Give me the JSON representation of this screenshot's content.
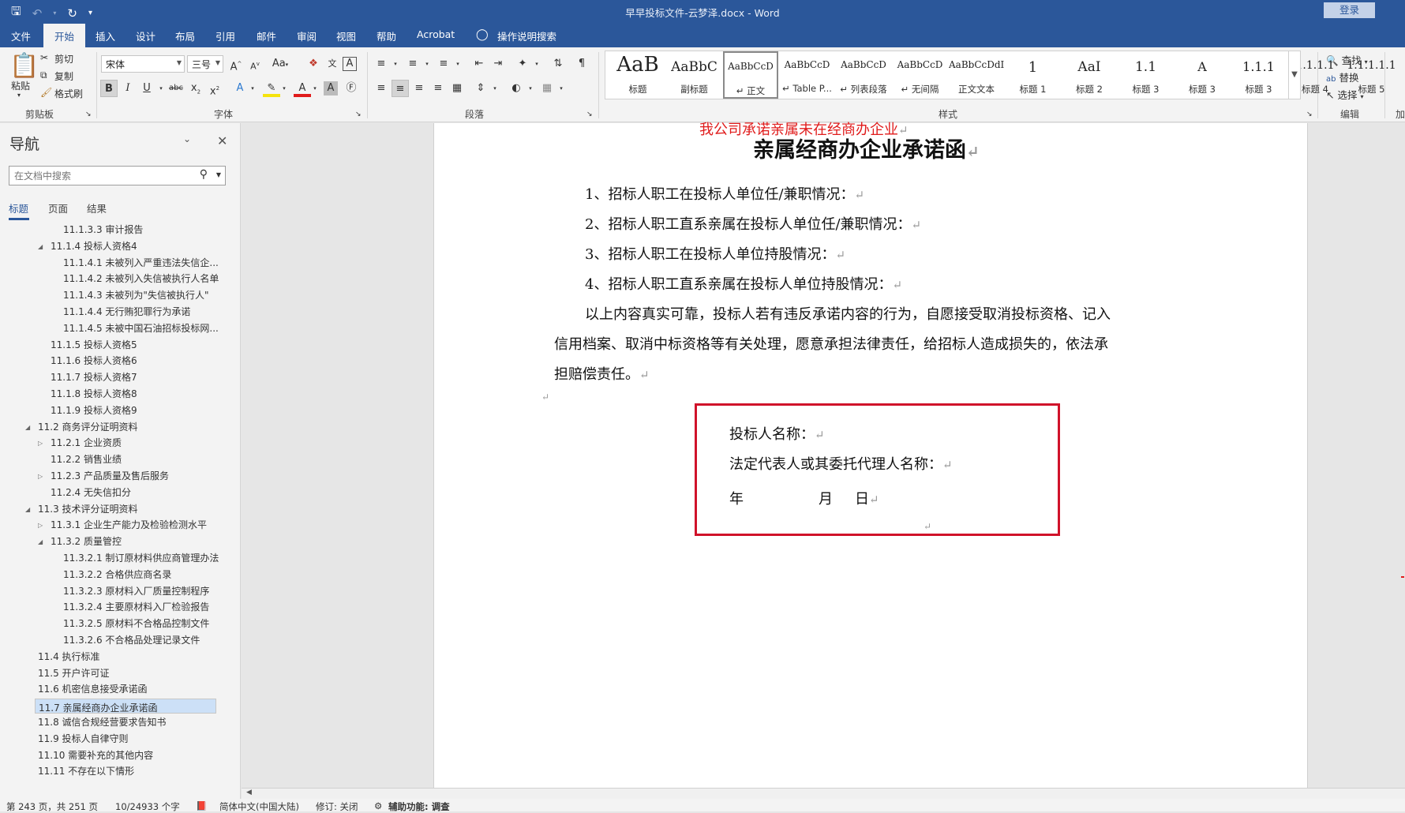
{
  "window": {
    "title": "早早投标文件-云梦泽.docx - Word",
    "login": "登录"
  },
  "menu": [
    {
      "label": "文件",
      "active": false
    },
    {
      "label": "开始",
      "active": true
    },
    {
      "label": "插入",
      "active": false
    },
    {
      "label": "设计",
      "active": false
    },
    {
      "label": "布局",
      "active": false
    },
    {
      "label": "引用",
      "active": false
    },
    {
      "label": "邮件",
      "active": false
    },
    {
      "label": "审阅",
      "active": false
    },
    {
      "label": "视图",
      "active": false
    },
    {
      "label": "帮助",
      "active": false
    },
    {
      "label": "Acrobat",
      "active": false
    },
    {
      "label": "操作说明搜索",
      "active": false
    }
  ],
  "ribbon": {
    "clipboard": {
      "paste": "粘贴",
      "cut": "剪切",
      "copy": "复制",
      "format_painter": "格式刷",
      "label": "剪贴板"
    },
    "font": {
      "name": "宋体",
      "size": "三号",
      "label": "字体",
      "case": "Aa"
    },
    "paragraph_label": "段落",
    "styles_label": "样式",
    "styles": [
      {
        "preview": "AaB",
        "name": "标题",
        "selected": false,
        "size": 26
      },
      {
        "preview": "AaBbC",
        "name": "副标题",
        "selected": false,
        "size": 17
      },
      {
        "preview": "AaBbCcD",
        "name": "↵ 正文",
        "selected": true,
        "size": 12
      },
      {
        "preview": "AaBbCcD",
        "name": "↵ Table P...",
        "selected": false,
        "size": 12
      },
      {
        "preview": "AaBbCcD",
        "name": "↵ 列表段落",
        "selected": false,
        "size": 12
      },
      {
        "preview": "AaBbCcD",
        "name": "↵ 无间隔",
        "selected": false,
        "size": 12
      },
      {
        "preview": "AaBbCcDdI",
        "name": "正文文本",
        "selected": false,
        "size": 12
      },
      {
        "preview": "1",
        "name": "标题 1",
        "selected": false,
        "size": 18
      },
      {
        "preview": "AaI",
        "name": "标题 2",
        "selected": false,
        "size": 17
      },
      {
        "preview": "1.1",
        "name": "标题 3",
        "selected": false,
        "size": 17
      },
      {
        "preview": "A",
        "name": "标题 3",
        "selected": false,
        "size": 16
      },
      {
        "preview": "1.1.1",
        "name": "标题 3",
        "selected": false,
        "size": 16
      },
      {
        "preview": "1.1.1.1",
        "name": "标题 4",
        "selected": false,
        "size": 14
      },
      {
        "preview": "1.1.1.1.1",
        "name": "标题 5",
        "selected": false,
        "size": 14
      }
    ],
    "editing": {
      "find": "查找",
      "replace": "替换",
      "select": "选择",
      "label": "编辑",
      "partial": "加"
    }
  },
  "nav": {
    "title": "导航",
    "search_placeholder": "在文档中搜索",
    "tabs": [
      "标题",
      "页面",
      "结果"
    ],
    "items": [
      {
        "label": "11.1.3.3 审计报告",
        "level": 3,
        "toggle": ""
      },
      {
        "label": "11.1.4 投标人资格4",
        "level": 2,
        "toggle": "expanded"
      },
      {
        "label": "11.1.4.1 未被列入严重违法失信企...",
        "level": 3,
        "toggle": ""
      },
      {
        "label": "11.1.4.2 未被列入失信被执行人名单",
        "level": 3,
        "toggle": ""
      },
      {
        "label": "11.1.4.3 未被列为\"失信被执行人\"",
        "level": 3,
        "toggle": ""
      },
      {
        "label": "11.1.4.4 无行贿犯罪行为承诺",
        "level": 3,
        "toggle": ""
      },
      {
        "label": "11.1.4.5 未被中国石油招标投标网...",
        "level": 3,
        "toggle": ""
      },
      {
        "label": "11.1.5 投标人资格5",
        "level": 2,
        "toggle": ""
      },
      {
        "label": "11.1.6 投标人资格6",
        "level": 2,
        "toggle": ""
      },
      {
        "label": "11.1.7 投标人资格7",
        "level": 2,
        "toggle": ""
      },
      {
        "label": "11.1.8 投标人资格8",
        "level": 2,
        "toggle": ""
      },
      {
        "label": "11.1.9 投标人资格9",
        "level": 2,
        "toggle": ""
      },
      {
        "label": "11.2 商务评分证明资料",
        "level": 1,
        "toggle": "expanded"
      },
      {
        "label": "11.2.1 企业资质",
        "level": 2,
        "toggle": "collapsed"
      },
      {
        "label": "11.2.2 销售业绩",
        "level": 2,
        "toggle": ""
      },
      {
        "label": "11.2.3 产品质量及售后服务",
        "level": 2,
        "toggle": "collapsed"
      },
      {
        "label": "11.2.4 无失信扣分",
        "level": 2,
        "toggle": ""
      },
      {
        "label": "11.3 技术评分证明资料",
        "level": 1,
        "toggle": "expanded"
      },
      {
        "label": "11.3.1 企业生产能力及检验检测水平",
        "level": 2,
        "toggle": "collapsed"
      },
      {
        "label": "11.3.2 质量管控",
        "level": 2,
        "toggle": "expanded"
      },
      {
        "label": "11.3.2.1 制订原材料供应商管理办法",
        "level": 3,
        "toggle": ""
      },
      {
        "label": "11.3.2.2 合格供应商名录",
        "level": 3,
        "toggle": ""
      },
      {
        "label": "11.3.2.3 原材料入厂质量控制程序",
        "level": 3,
        "toggle": ""
      },
      {
        "label": "11.3.2.4 主要原材料入厂检验报告",
        "level": 3,
        "toggle": ""
      },
      {
        "label": "11.3.2.5 原材料不合格品控制文件",
        "level": 3,
        "toggle": ""
      },
      {
        "label": "11.3.2.6 不合格品处理记录文件",
        "level": 3,
        "toggle": ""
      },
      {
        "label": "11.4 执行标准",
        "level": 1,
        "toggle": ""
      },
      {
        "label": "11.5 开户许可证",
        "level": 1,
        "toggle": ""
      },
      {
        "label": "11.6 机密信息接受承诺函",
        "level": 1,
        "toggle": ""
      },
      {
        "label": "11.7 亲属经商办企业承诺函",
        "level": 1,
        "toggle": "",
        "selected": true
      },
      {
        "label": "11.8 诚信合规经营要求告知书",
        "level": 1,
        "toggle": ""
      },
      {
        "label": "11.9 投标人自律守则",
        "level": 1,
        "toggle": ""
      },
      {
        "label": "11.10 需要补充的其他内容",
        "level": 1,
        "toggle": ""
      },
      {
        "label": "11.11 不存在以下情形",
        "level": 1,
        "toggle": ""
      }
    ]
  },
  "doc": {
    "red_header": "我公司承诺亲属未在经商办企业",
    "heading": "亲属经商办企业承诺函",
    "items": [
      "1、招标人职工在投标人单位任/兼职情况：",
      "2、招标人职工直系亲属在投标人单位任/兼职情况：",
      "3、招标人职工在投标人单位持股情况：",
      "4、招标人职工直系亲属在投标人单位持股情况："
    ],
    "body_lines": [
      "以上内容真实可靠，投标人若有违反承诺内容的行为，自愿接受取消投标资格、记入",
      "信用档案、取消中标资格等有关处理，愿意承担法律责任，给招标人造成损失的，依法承",
      "担赔偿责任。"
    ],
    "sign_name": "投标人名称：",
    "sign_rep": "法定代表人或其委托代理人名称：",
    "date_year": "年",
    "date_month": "月",
    "date_day": "日",
    "para_mark": "↵"
  },
  "status": {
    "page": "第 243 页，共 251 页",
    "words": "10/24933 个字",
    "lang": "简体中文(中国大陆)",
    "track": "修订: 关闭",
    "access": "辅助功能: 调查"
  },
  "colors": {
    "accent": "#2b579a",
    "red_box": "#d0122a",
    "red_text": "#e01b1b"
  }
}
